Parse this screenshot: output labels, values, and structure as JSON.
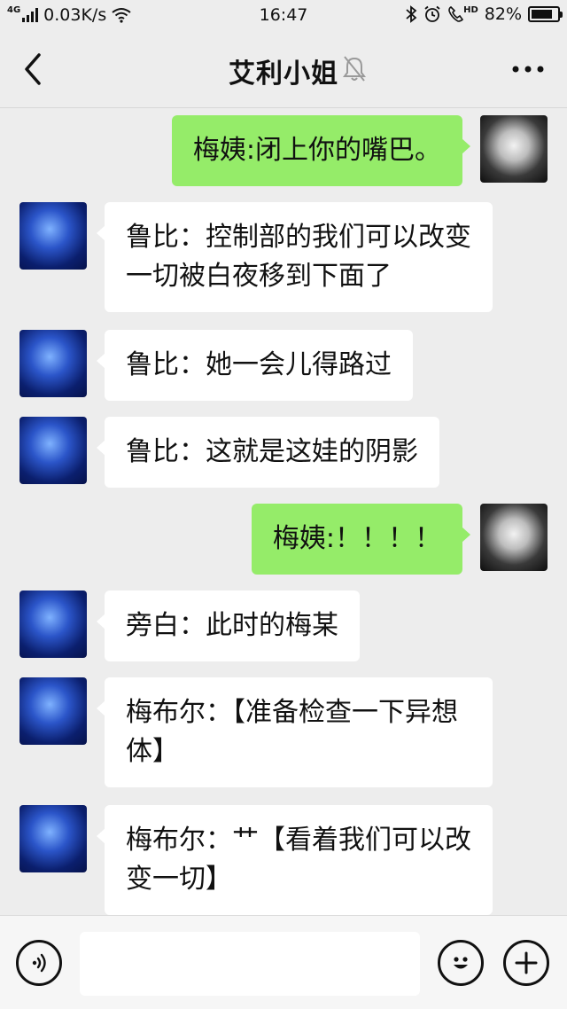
{
  "status_bar": {
    "network": "4G",
    "speed": "0.03K/s",
    "time": "16:47",
    "hd": "HD",
    "battery": "82%",
    "battery_level": 0.82
  },
  "header": {
    "title": "艾利小姐",
    "muted": true
  },
  "messages": [
    {
      "side": "out",
      "text": "梅姨:闭上你的嘴巴。"
    },
    {
      "side": "in",
      "text": "鲁比：控制部的我们可以改变一切被白夜移到下面了"
    },
    {
      "side": "in",
      "text": "鲁比：她一会儿得路过"
    },
    {
      "side": "in",
      "text": "鲁比：这就是这娃的阴影"
    },
    {
      "side": "out",
      "text": "梅姨:！！！！"
    },
    {
      "side": "in",
      "text": "旁白：此时的梅某"
    },
    {
      "side": "in",
      "text": "梅布尔：【准备检查一下异想体】"
    },
    {
      "side": "in",
      "text": "梅布尔：艹【看着我们可以改变一切】"
    }
  ],
  "colors": {
    "background": "#ededed",
    "outgoing_bubble": "#95ec69",
    "incoming_bubble": "#ffffff"
  },
  "icons": {
    "back": "back-arrow-icon",
    "mute": "bell-muted-icon",
    "more": "more-dots-icon",
    "voice": "voice-icon",
    "emoji": "emoji-icon",
    "plus": "plus-icon"
  }
}
